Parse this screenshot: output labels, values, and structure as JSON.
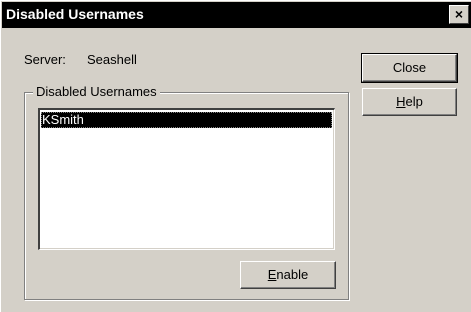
{
  "window": {
    "title": "Disabled Usernames",
    "close_glyph": "×"
  },
  "server": {
    "label": "Server:",
    "value": "Seashell"
  },
  "group": {
    "legend": "Disabled Usernames",
    "items": [
      {
        "label": "KSmith",
        "selected": true
      }
    ]
  },
  "buttons": {
    "close": {
      "label": "Close"
    },
    "help": {
      "mnemonic": "H",
      "rest": "elp"
    },
    "enable": {
      "mnemonic": "E",
      "rest": "nable"
    }
  },
  "colors": {
    "face": "#d4d0c8",
    "titlebar": "#000000",
    "selection": "#000000"
  }
}
